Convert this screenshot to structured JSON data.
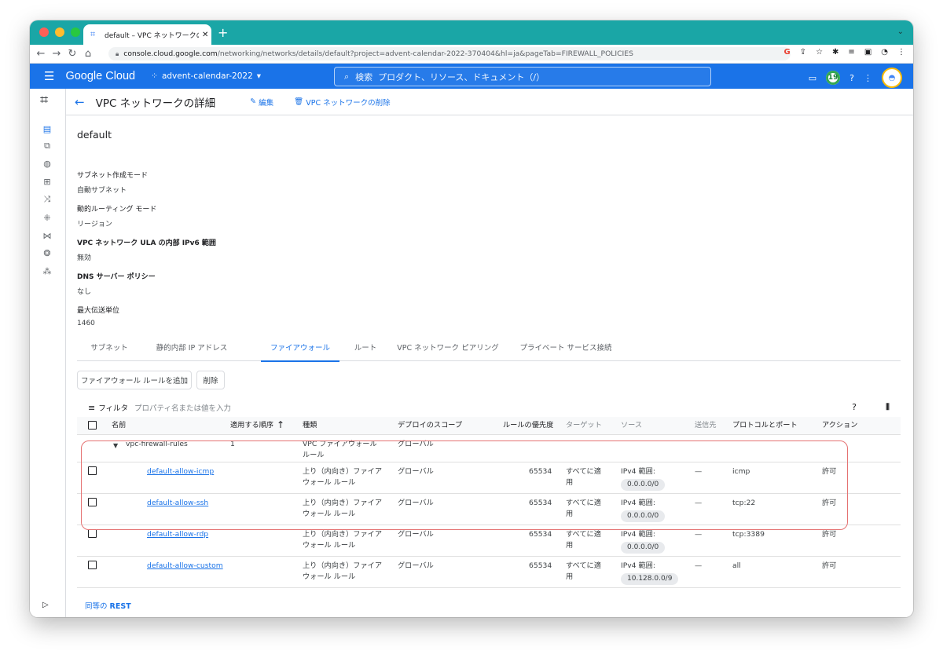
{
  "browser": {
    "tab_title": "default – VPC ネットワークの詳細",
    "tab_close": "✕",
    "new_tab": "+",
    "url_host": "console.cloud.google.com",
    "url_path": "/networking/networks/details/default?project=advent-calendar-2022-370404&hl=ja&pageTab=FIREWALL_POLICIES"
  },
  "gcp_header": {
    "brand": "Google Cloud",
    "project": "advent-calendar-2022",
    "search_label": "検索",
    "search_placeholder": "プロダクト、リソース、ドキュメント（/）",
    "notification_count": "19"
  },
  "page": {
    "title": "VPC ネットワークの詳細",
    "edit_label": "編集",
    "delete_label": "VPC ネットワークの削除",
    "network_name": "default"
  },
  "properties": [
    {
      "label": "サブネット作成モード",
      "value": "自動サブネット"
    },
    {
      "label": "動的ルーティング モード",
      "value": "リージョン"
    },
    {
      "label": "VPC ネットワーク ULA の内部 IPv6 範囲",
      "value": "無効"
    },
    {
      "label": "DNS サーバー ポリシー",
      "value": "なし"
    },
    {
      "label": "最大伝送単位",
      "value": "1460"
    }
  ],
  "tabs": [
    {
      "label": "サブネット",
      "active": false
    },
    {
      "label": "静的内部 IP アドレス",
      "active": false
    },
    {
      "label": "ファイアウォール",
      "active": true
    },
    {
      "label": "ルート",
      "active": false
    },
    {
      "label": "VPC ネットワーク ピアリング",
      "active": false
    },
    {
      "label": "プライベート サービス接続",
      "active": false
    }
  ],
  "actions": {
    "add_rule": "ファイアウォール ルールを追加",
    "delete": "削除"
  },
  "filter": {
    "label": "フィルタ",
    "placeholder": "プロパティ名または値を入力"
  },
  "table": {
    "headers": {
      "name": "名前",
      "order": "適用する順序",
      "type": "種類",
      "scope": "デプロイのスコープ",
      "priority": "ルールの優先度",
      "target": "ターゲット",
      "source": "ソース",
      "dest": "送信先",
      "protocol": "プロトコルとポート",
      "action": "アクション"
    },
    "group": {
      "name": "vpc-firewall-rules",
      "order": "1",
      "type_line1": "VPC ファイアウォール",
      "type_line2": "ルール",
      "scope": "グローバル"
    },
    "rows": [
      {
        "name": "default-allow-icmp",
        "type_line1": "上り（内向き）ファイア",
        "type_line2": "ウォール ルール",
        "scope": "グローバル",
        "priority": "65534",
        "target_line1": "すべてに適",
        "target_line2": "用",
        "source_label": "IPv4 範囲:",
        "source_chip": "0.0.0.0/0",
        "dest": "—",
        "protocol": "icmp",
        "action": "許可"
      },
      {
        "name": "default-allow-ssh",
        "type_line1": "上り（内向き）ファイア",
        "type_line2": "ウォール ルール",
        "scope": "グローバル",
        "priority": "65534",
        "target_line1": "すべてに適",
        "target_line2": "用",
        "source_label": "IPv4 範囲:",
        "source_chip": "0.0.0.0/0",
        "dest": "—",
        "protocol": "tcp:22",
        "action": "許可"
      },
      {
        "name": "default-allow-rdp",
        "type_line1": "上り（内向き）ファイア",
        "type_line2": "ウォール ルール",
        "scope": "グローバル",
        "priority": "65534",
        "target_line1": "すべてに適",
        "target_line2": "用",
        "source_label": "IPv4 範囲:",
        "source_chip": "0.0.0.0/0",
        "dest": "—",
        "protocol": "tcp:3389",
        "action": "許可"
      },
      {
        "name": "default-allow-custom",
        "type_line1": "上り（内向き）ファイア",
        "type_line2": "ウォール ルール",
        "scope": "グローバル",
        "priority": "65534",
        "target_line1": "すべてに適",
        "target_line2": "用",
        "source_label": "IPv4 範囲:",
        "source_chip": "10.128.0.0/9",
        "dest": "—",
        "protocol": "all",
        "action": "許可"
      }
    ]
  },
  "footer": {
    "rest_prefix": "同等の",
    "rest_label": "REST"
  },
  "colors": {
    "tabstrip": "#1aa6a6",
    "gcp_blue": "#1a73e8",
    "highlight_outline": "#e57373"
  }
}
